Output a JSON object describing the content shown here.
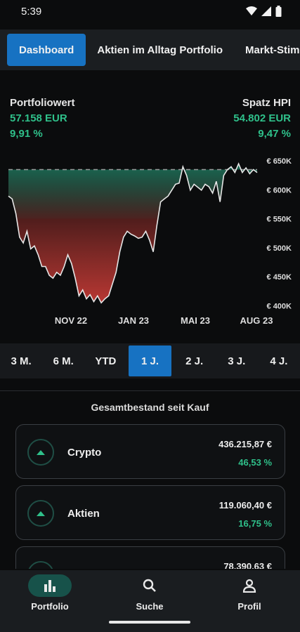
{
  "status": {
    "time": "5:39"
  },
  "tabs": [
    {
      "label": "Dashboard",
      "active": true
    },
    {
      "label": "Aktien im Alltag Portfolio",
      "active": false
    },
    {
      "label": "Markt-Stim",
      "active": false
    }
  ],
  "header": {
    "left": {
      "label": "Portfoliowert",
      "value": "57.158 EUR",
      "change": "9,91 %"
    },
    "right": {
      "label": "Spatz HPI",
      "value": "54.802 EUR",
      "change": "9,47 %"
    }
  },
  "chart_data": {
    "type": "area",
    "x_ticks": [
      "NOV 22",
      "JAN 23",
      "MAI 23",
      "AUG 23"
    ],
    "y_ticks": [
      "€ 650K",
      "€ 600K",
      "€ 550K",
      "€ 500K",
      "€ 450K",
      "€ 400K"
    ],
    "ylim": [
      400000,
      650000
    ],
    "reference_value": 635000,
    "colors": {
      "below": "#c23a35",
      "above": "#1f8a6c",
      "line": "#e6e6e6"
    },
    "values": [
      590000,
      585000,
      560000,
      520000,
      510000,
      530000,
      500000,
      505000,
      490000,
      470000,
      470000,
      455000,
      450000,
      460000,
      455000,
      470000,
      490000,
      475000,
      450000,
      420000,
      430000,
      415000,
      422000,
      410000,
      420000,
      408000,
      415000,
      420000,
      440000,
      460000,
      495000,
      520000,
      530000,
      525000,
      522000,
      518000,
      520000,
      530000,
      515000,
      495000,
      540000,
      580000,
      585000,
      590000,
      600000,
      610000,
      612000,
      640000,
      625000,
      600000,
      610000,
      605000,
      600000,
      610000,
      606000,
      595000,
      615000,
      580000,
      625000,
      635000,
      640000,
      630000,
      645000,
      630000,
      638000,
      628000,
      635000,
      630000
    ]
  },
  "ranges": [
    {
      "label": "3 M.",
      "active": false
    },
    {
      "label": "6 M.",
      "active": false
    },
    {
      "label": "YTD",
      "active": false
    },
    {
      "label": "1 J.",
      "active": true
    },
    {
      "label": "2 J.",
      "active": false
    },
    {
      "label": "3 J.",
      "active": false
    },
    {
      "label": "4 J.",
      "active": false
    }
  ],
  "section_title": "Gesamtbestand seit Kauf",
  "holdings": [
    {
      "name": "Crypto",
      "amount": "436.215,87 €",
      "change": "46,53 %"
    },
    {
      "name": "Aktien",
      "amount": "119.060,40 €",
      "change": "16,75 %"
    },
    {
      "name": "",
      "amount": "78.390,63 €",
      "change": ""
    }
  ],
  "nav": [
    {
      "label": "Portfolio",
      "icon": "bar-chart-icon",
      "active": true
    },
    {
      "label": "Suche",
      "icon": "search-icon",
      "active": false
    },
    {
      "label": "Profil",
      "icon": "person-icon",
      "active": false
    }
  ]
}
